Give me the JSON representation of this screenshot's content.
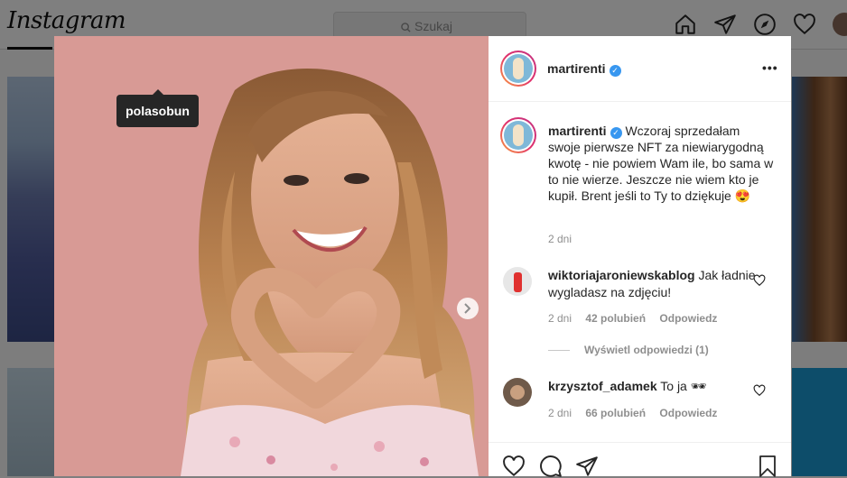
{
  "app": {
    "logo": "Instagram",
    "search_placeholder": "Szukaj",
    "nav_icons": [
      "home-icon",
      "direct-icon",
      "explore-icon",
      "activity-icon",
      "profile-avatar"
    ]
  },
  "photo": {
    "tag_tooltip": "polasobun"
  },
  "post": {
    "author": "martirenti",
    "verified": true,
    "more_label": "•••",
    "caption": "Wczoraj sprzedałam swoje pierwsze NFT za niewiarygodną kwotę - nie powiem Wam ile, bo sama w to nie wierze. Jeszcze nie wiem kto je kupił. Brent jeśli to Ty to dziękuje",
    "caption_emoji": "😍",
    "caption_time": "2 dni"
  },
  "comments": [
    {
      "user": "wiktoriajaroniewskablog",
      "text": "Jak ładnie wygladasz na zdjęciu!",
      "time": "2 dni",
      "likes": "42 polubień",
      "reply": "Odpowiedz",
      "view_replies": "Wyświetl odpowiedzi (1)"
    },
    {
      "user": "krzysztof_adamek",
      "text": "To ja 🕶",
      "time": "2 dni",
      "likes": "66 polubień",
      "reply": "Odpowiedz"
    }
  ],
  "colors": {
    "verified": "#3897f0",
    "text": "#262626",
    "meta": "#8e8e8e",
    "photo_bg": "#d79893"
  }
}
